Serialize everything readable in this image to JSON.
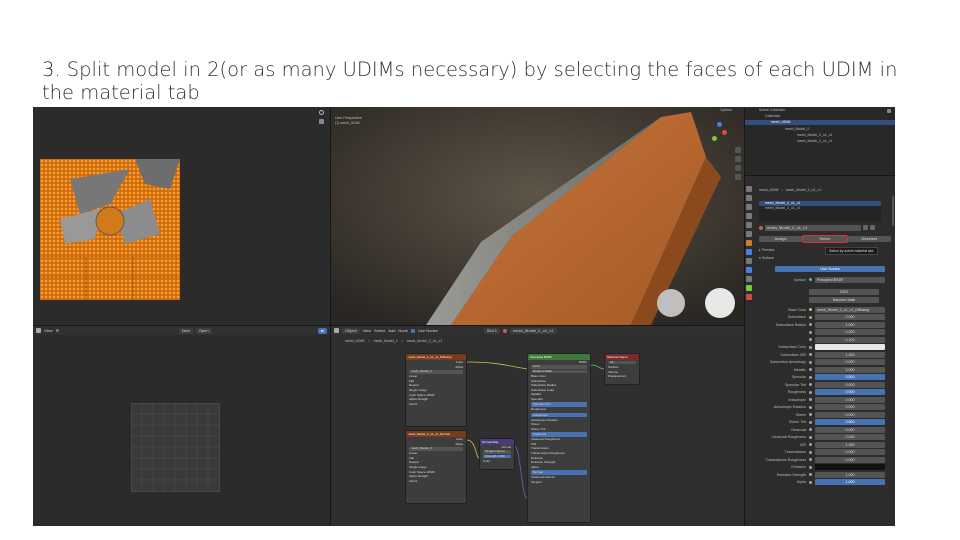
{
  "slide": {
    "title": "3. Split model in 2(or as many UDIMs necessary) by selecting the faces of each UDIM in the material tab"
  },
  "viewport3d": {
    "view_label": "User Perspective",
    "object_label": "(1) mesh_UDIM",
    "options_label": "Options"
  },
  "uv_editor": {
    "view_label": "View",
    "new_label": "New",
    "open_label": "Open"
  },
  "node_editor": {
    "object_label": "Object",
    "menu": [
      "View",
      "Select",
      "Add",
      "Node"
    ],
    "use_nodes_label": "Use Nodes",
    "slot_label": "Slot 1",
    "material_label": "mesh_Model_2_u1_v1",
    "breadcrumb": [
      "mesh_UDIM",
      "mesh_Model_2",
      "mesh_Model_2_u1_v1"
    ],
    "texture_node_1": {
      "title": "mesh_Model_2_u1_v1_Diffusing",
      "outputs": [
        "Color",
        "Alpha"
      ],
      "image": "mesh_Model_2",
      "options": [
        "Linear",
        "Flat",
        "Repeat",
        "Single Image"
      ],
      "color_space_label": "Color Space",
      "color_space": "sRGB",
      "alpha_label": "Alpha",
      "alpha": "Straight",
      "vector_label": "Vector"
    },
    "texture_node_2": {
      "title": "mesh_Model_2_u1_v1_Normal",
      "outputs": [
        "Color",
        "Alpha"
      ],
      "image": "mesh_Model_2",
      "options": [
        "Linear",
        "Flat",
        "Repeat",
        "Single Image"
      ],
      "color_space_label": "Color Space",
      "color_space": "sRGB",
      "alpha_label": "Alpha",
      "alpha": "Straight",
      "vector_label": "Vector"
    },
    "normal_map_node": {
      "title": "Normal Map",
      "output": "Normal",
      "space": "Tangent Space",
      "strength_label": "Strength",
      "strength": "1.000",
      "color_label": "Color"
    },
    "principled_node": {
      "title": "Principled BSDF",
      "output": "BSDF",
      "distribution": "GGX",
      "subsurface_method": "Random Walk",
      "inputs": [
        "Base Color",
        "Subsurface",
        "Subsurface Radius",
        "Subsurface Color",
        "Metallic",
        "Specular",
        "Specular Tint",
        "Roughness",
        "Anisotropic",
        "Anisotropic Rotation",
        "Sheen",
        "Sheen Tint",
        "Clearcoat",
        "Clearcoat Roughness",
        "IOR",
        "Transmission",
        "Transmission Roughness",
        "Emission",
        "Emission Strength",
        "Alpha",
        "Normal",
        "Clearcoat Normal",
        "Tangent"
      ]
    },
    "output_node": {
      "title": "Material Output",
      "target": "All",
      "inputs": [
        "Surface",
        "Volume",
        "Displacement"
      ]
    }
  },
  "outliner": {
    "title": "Scene Collection",
    "items": [
      "Collection",
      "mesh_UDIM",
      "mesh_Model_2",
      "mesh_Model_2_u1_v1",
      "mesh_Model_2_u1_v1"
    ]
  },
  "properties": {
    "breadcrumb": [
      "mesh_UDIM",
      "mesh_Model_2_u1_v1"
    ],
    "slots": [
      "mesh_Model_2_u1_v1",
      "mesh_Model_2_u1_v1"
    ],
    "material_name": "mesh_Model_2_u1_v1",
    "buttons": {
      "assign": "Assign",
      "select": "Select",
      "deselect": "Deselect"
    },
    "tooltip": "Select by active material slot.",
    "sections": {
      "preview": "Preview",
      "surface": "Surface"
    },
    "use_nodes": "Use Nodes",
    "surface_label": "Surface",
    "surface_value": "Principled BSDF",
    "distribution": "GGX",
    "subsurface_method": "Random Walk",
    "fields": [
      {
        "label": "Base Color",
        "value": "mesh_Model_2_u1_v1_Diffusing",
        "style": "link"
      },
      {
        "label": "Subsurface",
        "value": "0.000",
        "style": "plain"
      },
      {
        "label": "Subsurface Radius",
        "value": "1.000",
        "style": "plain"
      },
      {
        "label": "",
        "value": "0.200",
        "style": "plain"
      },
      {
        "label": "",
        "value": "0.100",
        "style": "plain"
      },
      {
        "label": "Subsurface Color",
        "value": "",
        "style": "white"
      },
      {
        "label": "Subsurface IOR",
        "value": "1.400",
        "style": "plain"
      },
      {
        "label": "Subsurface Anisotropy",
        "value": "0.000",
        "style": "plain"
      },
      {
        "label": "Metallic",
        "value": "0.000",
        "style": "plain"
      },
      {
        "label": "Specular",
        "value": "0.500",
        "style": "blue"
      },
      {
        "label": "Specular Tint",
        "value": "0.000",
        "style": "plain"
      },
      {
        "label": "Roughness",
        "value": "0.500",
        "style": "blue"
      },
      {
        "label": "Anisotropic",
        "value": "0.000",
        "style": "plain"
      },
      {
        "label": "Anisotropic Rotation",
        "value": "0.000",
        "style": "plain"
      },
      {
        "label": "Sheen",
        "value": "0.000",
        "style": "plain"
      },
      {
        "label": "Sheen Tint",
        "value": "0.500",
        "style": "blue"
      },
      {
        "label": "Clearcoat",
        "value": "0.000",
        "style": "plain"
      },
      {
        "label": "Clearcoat Roughness",
        "value": "0.030",
        "style": "plain"
      },
      {
        "label": "IOR",
        "value": "1.450",
        "style": "plain"
      },
      {
        "label": "Transmission",
        "value": "0.000",
        "style": "plain"
      },
      {
        "label": "Transmission Roughness",
        "value": "0.000",
        "style": "plain"
      },
      {
        "label": "Emission",
        "value": "",
        "style": "black"
      },
      {
        "label": "Emission Strength",
        "value": "1.000",
        "style": "plain"
      },
      {
        "label": "Alpha",
        "value": "1.000",
        "style": "blue"
      }
    ]
  },
  "colors": {
    "ui_bg": "#262626",
    "header": "#303030",
    "accent_blue": "#4772b3",
    "selection_orange": "#f08a1c",
    "highlight_red": "#e03030",
    "texture_node_header": "#7a3b1a",
    "shader_node_header": "#3d7a3a",
    "output_node_header": "#7a2a2a",
    "vector_node_header": "#4a3a7a"
  }
}
